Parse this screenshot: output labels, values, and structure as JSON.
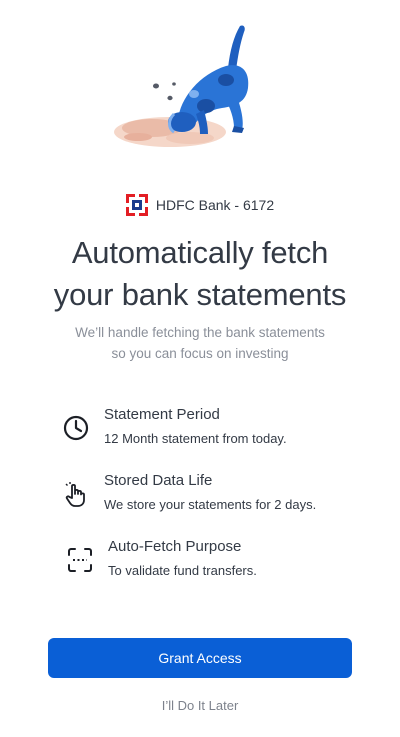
{
  "bank": {
    "name": "HDFC Bank - 6172",
    "logo_icon": "hdfc-logo-icon",
    "logo_colors": {
      "red": "#e31e24",
      "blue": "#1a3c8e"
    }
  },
  "title": {
    "line1": "Automatically fetch",
    "line2": "your bank statements"
  },
  "subtitle": {
    "line1": "We’ll handle fetching the bank statements",
    "line2": "so you can focus on investing"
  },
  "features": [
    {
      "icon": "clock-icon",
      "title": "Statement Period",
      "description": "12 Month statement from today."
    },
    {
      "icon": "pointing-hand-icon",
      "title": "Stored Data Life",
      "description": "We store your statements for 2 days."
    },
    {
      "icon": "scan-frame-icon",
      "title": "Auto-Fetch Purpose",
      "description": "To validate fund transfers."
    }
  ],
  "actions": {
    "primary_label": "Grant Access",
    "secondary_label": "I’ll Do It Later"
  },
  "colors": {
    "accent": "#0a5fd6",
    "text": "#333a45",
    "muted": "#8a8f99"
  },
  "illustration": "dog-digging-illustration"
}
